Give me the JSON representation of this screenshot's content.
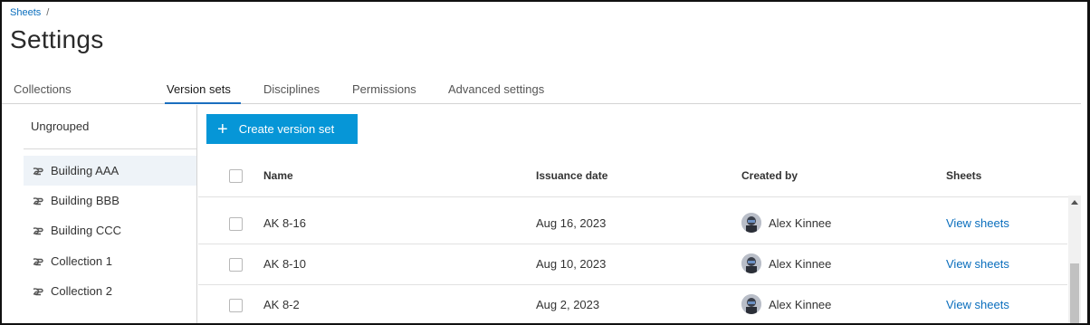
{
  "breadcrumb": {
    "root": "Sheets",
    "separator": "/"
  },
  "page": {
    "title": "Settings"
  },
  "tabs": [
    {
      "label": "Collections",
      "active": false
    },
    {
      "label": "Version sets",
      "active": true
    },
    {
      "label": "Disciplines",
      "active": false
    },
    {
      "label": "Permissions",
      "active": false
    },
    {
      "label": "Advanced settings",
      "active": false
    }
  ],
  "sidebar": {
    "ungrouped_label": "Ungrouped",
    "items": [
      {
        "label": "Building AAA",
        "icon": "collection-icon",
        "selected": true
      },
      {
        "label": "Building BBB",
        "icon": "collection-icon",
        "selected": false
      },
      {
        "label": "Building CCC",
        "icon": "collection-icon",
        "selected": false
      },
      {
        "label": "Collection 1",
        "icon": "collection-icon",
        "selected": false
      },
      {
        "label": "Collection 2",
        "icon": "collection-icon",
        "selected": false
      }
    ]
  },
  "toolbar": {
    "create_label": "Create version set",
    "create_icon": "plus-icon"
  },
  "table": {
    "columns": {
      "name": "Name",
      "issuance_date": "Issuance date",
      "created_by": "Created by",
      "sheets": "Sheets"
    },
    "rows": [
      {
        "name": "AK 8-16",
        "date": "Aug 16, 2023",
        "creator": "Alex Kinnee",
        "link": "View sheets"
      },
      {
        "name": "AK 8-10",
        "date": "Aug 10, 2023",
        "creator": "Alex Kinnee",
        "link": "View sheets"
      },
      {
        "name": "AK 8-2",
        "date": "Aug 2, 2023",
        "creator": "Alex Kinnee",
        "link": "View sheets"
      }
    ]
  },
  "colors": {
    "primary": "#0696d7",
    "link": "#0a6ebd",
    "tab_underline": "#1b6fbf",
    "selected_bg": "#eef3f8"
  }
}
